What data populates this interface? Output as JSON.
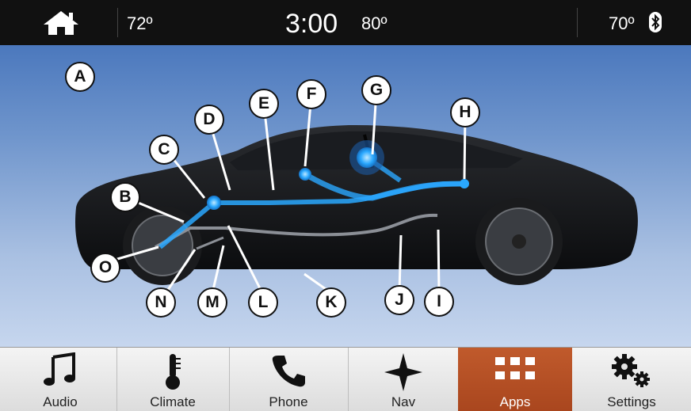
{
  "status_bar": {
    "cabin_temp_left": "72º",
    "time": "3:00",
    "outside_temp": "80º",
    "cabin_temp_right": "70º",
    "icons": [
      "home-icon",
      "bluetooth-icon"
    ]
  },
  "diagram": {
    "callouts": [
      "A",
      "B",
      "C",
      "D",
      "E",
      "F",
      "G",
      "H",
      "I",
      "J",
      "K",
      "L",
      "M",
      "N",
      "O"
    ],
    "highlight_color": "#2aa8ff"
  },
  "nav": {
    "items": [
      {
        "label": "Audio",
        "icon": "music-note-icon"
      },
      {
        "label": "Climate",
        "icon": "thermometer-icon"
      },
      {
        "label": "Phone",
        "icon": "phone-icon"
      },
      {
        "label": "Nav",
        "icon": "compass-star-icon"
      },
      {
        "label": "Apps",
        "icon": "apps-grid-icon",
        "active": true
      },
      {
        "label": "Settings",
        "icon": "gears-icon"
      }
    ],
    "active_color": "#b24e22"
  }
}
